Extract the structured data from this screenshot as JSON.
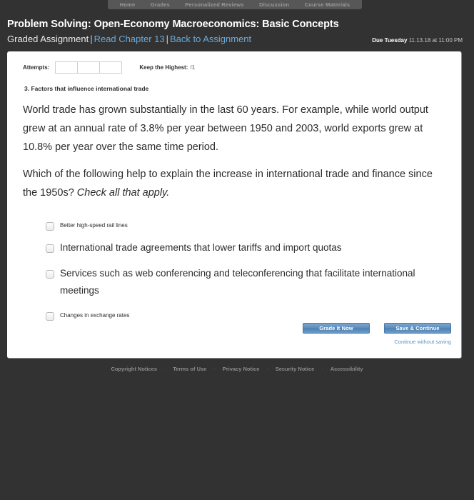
{
  "topnav": {
    "items": [
      {
        "label": "Home"
      },
      {
        "label": "Grades"
      },
      {
        "label": "Personalized Reviews"
      },
      {
        "label": "Discussion"
      },
      {
        "label": "Course Materials"
      }
    ]
  },
  "header": {
    "title": "Problem Solving: Open-Economy Macroeconomics: Basic Concepts",
    "assignment_type": "Graded Assignment",
    "separator": "|",
    "read_chapter_link": "Read Chapter 13",
    "back_link": "Back to Assignment",
    "due_prefix": "Due Tuesday",
    "due_value": "11.13.18 at 11:00 PM",
    "link_color": "#6aa9d8"
  },
  "attempts": {
    "label": "Attempts:",
    "boxes": [
      "",
      "",
      ""
    ],
    "keep_highest_label": "Keep the Highest:",
    "keep_highest_value": "/1"
  },
  "question": {
    "heading": "3. Factors that influence international trade",
    "paragraph_1": "World trade has grown substantially in the last 60 years. For example, while world output grew at an annual rate of 3.8% per year between 1950 and 2003, world exports grew at 10.8% per year over the same time period.",
    "paragraph_2_lead": "Which of the following help to explain the increase in international trade and finance since the 1950s? ",
    "paragraph_2_italic": "Check all that apply.",
    "options": [
      {
        "label": "Better high-speed rail lines",
        "size": "small",
        "checked": false
      },
      {
        "label": "International trade agreements that lower tariffs and import quotas",
        "size": "large",
        "checked": false
      },
      {
        "label": "Services such as web conferencing and teleconferencing that facilitate international meetings",
        "size": "large",
        "checked": false
      },
      {
        "label": "Changes in exchange rates",
        "size": "small",
        "checked": false
      }
    ]
  },
  "actions": {
    "grade_button": "Grade It Now",
    "save_button": "Save & Continue",
    "continue_without_saving": "Continue without saving",
    "button_color": "#5c8cbc"
  },
  "footer": {
    "links": [
      {
        "label": "Copyright Notices"
      },
      {
        "label": "Terms of Use"
      },
      {
        "label": "Privacy Notice"
      },
      {
        "label": "Security Notice"
      },
      {
        "label": "Accessibility"
      }
    ],
    "separator": "·"
  }
}
